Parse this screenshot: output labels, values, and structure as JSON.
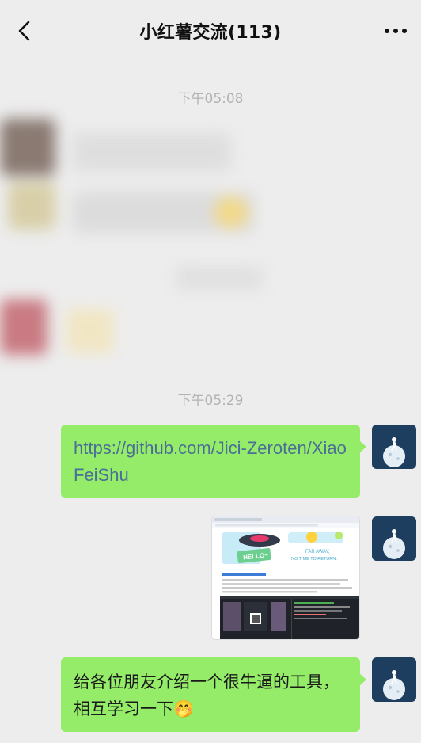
{
  "header": {
    "title": "小红薯交流(113)",
    "back_icon": "chevron-left-icon",
    "more_icon": "ellipsis-icon"
  },
  "timestamps": [
    "下午05:08",
    "下午05:29"
  ],
  "messages": [
    {
      "type": "text",
      "sender": "self",
      "text": "https://github.com/Jici-Zeroten/XiaoFeiShu"
    },
    {
      "type": "image",
      "sender": "self",
      "preview": {
        "banner_text_1": "HELLO~",
        "banner_text_2": "FAR AWAY,",
        "banner_text_3": "NO TIME TO RETURN."
      }
    },
    {
      "type": "text",
      "sender": "self",
      "text": "给各位朋友介绍一个很牛逼的工具，相互学习一下🤭"
    }
  ],
  "colors": {
    "background": "#ededed",
    "bubble_self": "#95ec69",
    "link": "#4b6e97",
    "timestamp": "#b2b2b2",
    "avatar": "#1d3e5e"
  }
}
